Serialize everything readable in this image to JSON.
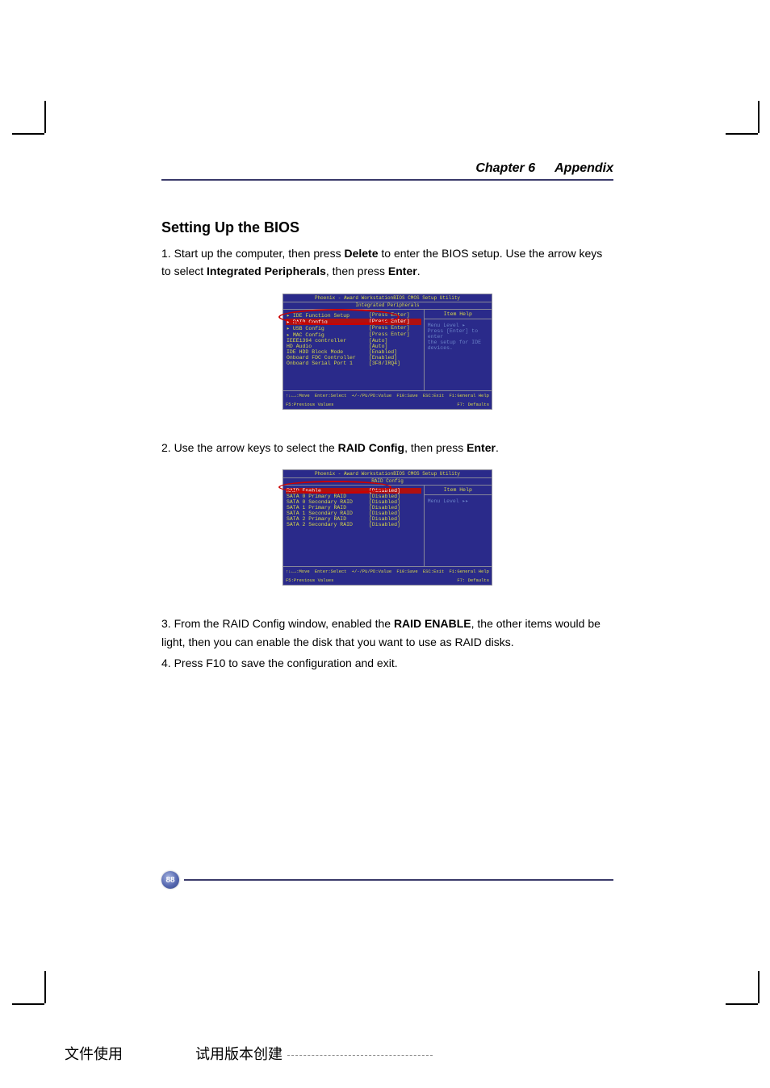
{
  "header": {
    "chapter": "Chapter 6",
    "title": "Appendix"
  },
  "section_title": "Setting Up the BIOS",
  "step1_a": "1. Start up the computer, then press ",
  "step1_b": "Delete",
  "step1_c": " to enter the BIOS setup. Use the arrow keys to select ",
  "step1_d": "Integrated Peripherals",
  "step1_e": ", then press ",
  "step1_f": "Enter",
  "step1_g": ".",
  "step2_a": "2. Use the arrow keys to select the ",
  "step2_b": "RAID Config",
  "step2_c": ", then press ",
  "step2_d": "Enter",
  "step2_e": ".",
  "step3_a": "3. From the RAID Config window, enabled the ",
  "step3_b": "RAID ENABLE",
  "step3_c": ", the other items would be light, then you can enable the disk that you want to use as RAID disks.",
  "step4": "4. Press F10 to save the configuration and exit.",
  "bios1": {
    "title": "Phoenix - Award WorkstationBIOS CMOS Setup Utility",
    "subtitle": "Integrated Peripherals",
    "rows": [
      {
        "k": "▸ IDE Function Setup",
        "v": "[Press Enter]"
      },
      {
        "k": "▸ RAID Config",
        "v": "[Press Enter]"
      },
      {
        "k": "▸ USB Config",
        "v": "[Press Enter]"
      },
      {
        "k": "▸ MAC Config",
        "v": "[Press Enter]"
      },
      {
        "k": "  IEEE1394 controller",
        "v": "[Auto]"
      },
      {
        "k": "  HD Audio",
        "v": "[Auto]"
      },
      {
        "k": "  IDE HDD Block Mode",
        "v": "[Enabled]"
      },
      {
        "k": "  Onboard FDC Controller",
        "v": "[Enabled]"
      },
      {
        "k": "  Onboard Serial Port 1",
        "v": "[3F8/IRQ4]"
      }
    ],
    "help_title": "Item Help",
    "help_lines": [
      "Menu Level  ▸",
      "Press [Enter] to enter",
      "the setup for IDE",
      "devices."
    ],
    "footer": [
      "↑↓←→:Move",
      "Enter:Select",
      "+/-/PU/PD:Value",
      "F10:Save",
      "ESC:Exit",
      "F1:General Help",
      "F5:Previous Values",
      "F7: Defaults"
    ]
  },
  "bios2": {
    "title": "Phoenix - Award WorkstationBIOS CMOS Setup Utility",
    "subtitle": "RAID Config",
    "rows": [
      {
        "k": "RAID Enable",
        "v": "[Disabled]"
      },
      {
        "k": "SATA 0 Primary    RAID",
        "v": "[Disabled]"
      },
      {
        "k": "SATA 0 Secondary  RAID",
        "v": "[Disabled]"
      },
      {
        "k": "SATA 1 Primary    RAID",
        "v": "[Disabled]"
      },
      {
        "k": "SATA 1 Secondary  RAID",
        "v": "[Disabled]"
      },
      {
        "k": "SATA 2 Primary    RAID",
        "v": "[Disabled]"
      },
      {
        "k": "SATA 2 Secondary  RAID",
        "v": "[Disabled]"
      }
    ],
    "help_title": "Item Help",
    "help_lines": [
      "Menu Level  ▸▸"
    ],
    "footer": [
      "↑↓←→:Move",
      "Enter:Select",
      "+/-/PU/PD:Value",
      "F10:Save",
      "ESC:Exit",
      "F1:General Help",
      "F5:Previous Values",
      "F7: Defaults"
    ]
  },
  "page_number": "88",
  "watermark_left": "文件使用",
  "watermark_right": "试用版本创建"
}
